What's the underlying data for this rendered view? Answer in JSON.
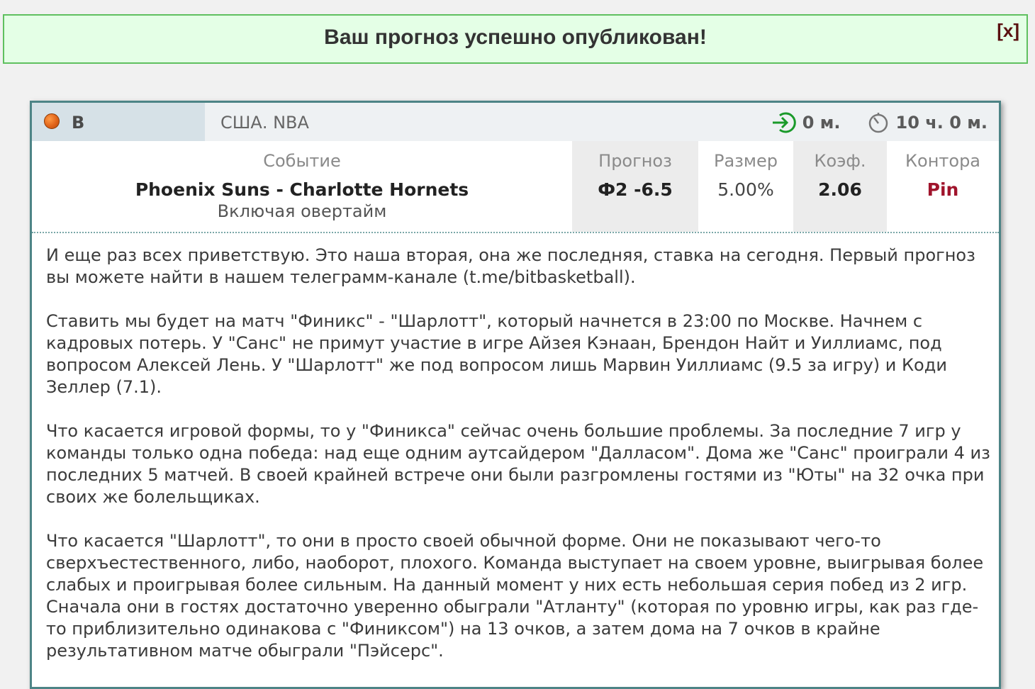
{
  "notice": {
    "text": "Ваш прогноз успешно опубликован!",
    "close_label": "[x]"
  },
  "card": {
    "sport_label": "В",
    "league": "США. NBA",
    "entry_time": "0 м.",
    "time_left": "10 ч. 0 м.",
    "columns": {
      "event_label": "Событие",
      "forecast_label": "Прогноз",
      "size_label": "Размер",
      "odds_label": "Коэф.",
      "bookie_label": "Контора"
    },
    "event": "Phoenix Suns - Charlotte Hornets",
    "event_note": "Включая овертайм",
    "forecast": "Ф2 -6.5",
    "size": "5.00%",
    "odds": "2.06",
    "bookie": "Pin"
  },
  "body": {
    "paragraphs": [
      "И еще раз всех приветствую. Это наша вторая, она же последняя, ставка на сегодня. Первый прогноз вы можете найти в нашем телеграмм-канале (t.me/bitbasketball).",
      "Ставить мы будет на матч \"Финикс\" - \"Шарлотт\", который начнется в 23:00 по Москве. Начнем с кадровых потерь. У \"Санс\" не примут участие в игре Айзея Кэнаан, Брендон Найт и Уиллиамс, под вопросом Алексей Лень. У \"Шарлотт\" же под вопросом лишь Марвин Уиллиамс (9.5 за игру) и Коди Зеллер (7.1).",
      "Что касается игровой формы, то у \"Финикса\" сейчас очень большие проблемы. За последние 7 игр у команды только одна победа: над еще одним аутсайдером \"Далласом\". Дома же \"Санс\" проиграли 4 из последних 5 матчей. В своей крайней встрече они были разгромлены гостями из \"Юты\" на 32 очка при своих же болельщиках.",
      "Что касается \"Шарлотт\", то они в просто своей обычной форме. Они не показывают чего-то сверхъестественного, либо, наоборот, плохого. Команда выступает на своем уровне, выигрывая более слабых и проигрывая более сильным. На данный момент у них есть небольшая серия побед из 2 игр. Сначала они в гостях достаточно уверенно обыграли \"Атланту\" (которая по уровню игры, как раз где-то приблизительно одинакова с \"Финиксом\") на 13 очков, а затем дома на 7 очков в крайне результативном матче обыграли \"Пэйсерс\"."
    ]
  },
  "colors": {
    "notice_bg": "#e4ffe6",
    "notice_border": "#5fc05f",
    "card_border": "#4d8486",
    "bookie": "#a0142c"
  },
  "icons": [
    "basketball-icon",
    "entry-arrow-icon",
    "timer-icon"
  ]
}
